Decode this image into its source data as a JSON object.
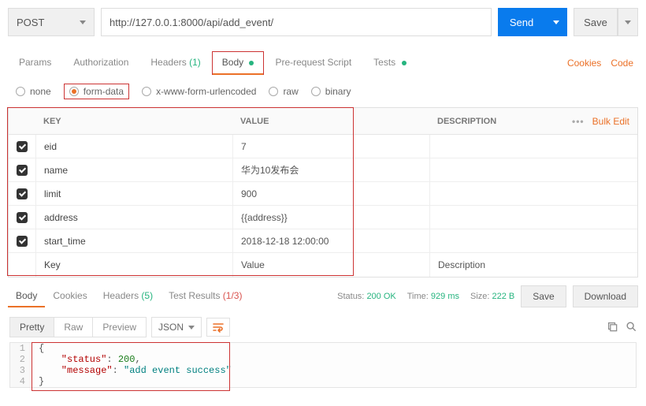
{
  "request": {
    "method": "POST",
    "url": "http://127.0.0.1:8000/api/add_event/",
    "send_label": "Send",
    "save_label": "Save"
  },
  "tabs": {
    "params": "Params",
    "auth": "Authorization",
    "headers": "Headers",
    "headers_count": "(1)",
    "body": "Body",
    "prerequest": "Pre-request Script",
    "tests": "Tests",
    "cookies_link": "Cookies",
    "code_link": "Code"
  },
  "body_types": {
    "none": "none",
    "formdata": "form-data",
    "urlencoded": "x-www-form-urlencoded",
    "raw": "raw",
    "binary": "binary"
  },
  "table": {
    "head_key": "KEY",
    "head_value": "VALUE",
    "head_desc": "DESCRIPTION",
    "bulk_edit": "Bulk Edit",
    "rows": [
      {
        "key": "eid",
        "value": "7"
      },
      {
        "key": "name",
        "value": "华为10发布会"
      },
      {
        "key": "limit",
        "value": "900"
      },
      {
        "key": "address",
        "value": "{{address}}",
        "is_var": true
      },
      {
        "key": "start_time",
        "value": "2018-12-18 12:00:00"
      }
    ],
    "ph_key": "Key",
    "ph_value": "Value",
    "ph_desc": "Description"
  },
  "response": {
    "tabs": {
      "body": "Body",
      "cookies": "Cookies",
      "headers": "Headers",
      "headers_cnt": "(5)",
      "tests": "Test Results",
      "tests_cnt": "(1/3)"
    },
    "status_label": "Status:",
    "status_value": "200 OK",
    "time_label": "Time:",
    "time_value": "929 ms",
    "size_label": "Size:",
    "size_value": "222 B",
    "save": "Save",
    "download": "Download"
  },
  "pretty": {
    "pretty": "Pretty",
    "raw": "Raw",
    "preview": "Preview",
    "lang": "JSON"
  },
  "json_body": {
    "l1": "{",
    "l2a": "    \"status\"",
    "l2b": ": ",
    "l2c": "200",
    "l2d": ",",
    "l3a": "    \"message\"",
    "l3b": ": ",
    "l3c": "\"add event success\"",
    "l4": "}"
  }
}
